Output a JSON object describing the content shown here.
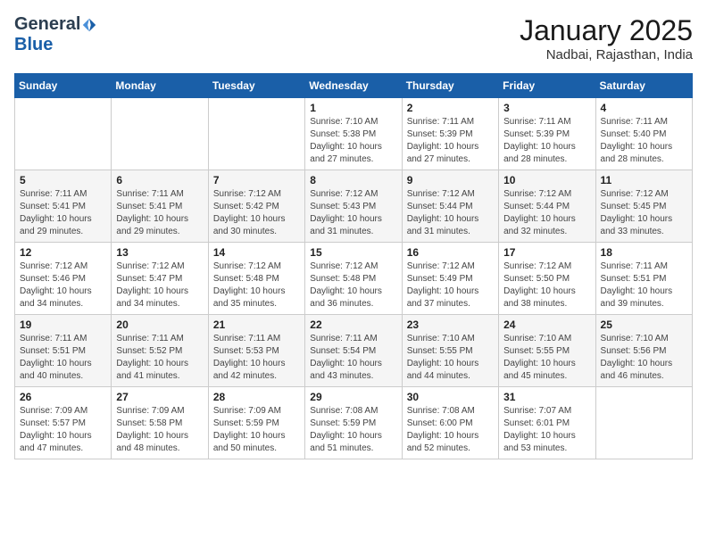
{
  "logo": {
    "general": "General",
    "blue": "Blue"
  },
  "header": {
    "month": "January 2025",
    "location": "Nadbai, Rajasthan, India"
  },
  "days_of_week": [
    "Sunday",
    "Monday",
    "Tuesday",
    "Wednesday",
    "Thursday",
    "Friday",
    "Saturday"
  ],
  "weeks": [
    [
      {
        "day": "",
        "info": ""
      },
      {
        "day": "",
        "info": ""
      },
      {
        "day": "",
        "info": ""
      },
      {
        "day": "1",
        "info": "Sunrise: 7:10 AM\nSunset: 5:38 PM\nDaylight: 10 hours\nand 27 minutes."
      },
      {
        "day": "2",
        "info": "Sunrise: 7:11 AM\nSunset: 5:39 PM\nDaylight: 10 hours\nand 27 minutes."
      },
      {
        "day": "3",
        "info": "Sunrise: 7:11 AM\nSunset: 5:39 PM\nDaylight: 10 hours\nand 28 minutes."
      },
      {
        "day": "4",
        "info": "Sunrise: 7:11 AM\nSunset: 5:40 PM\nDaylight: 10 hours\nand 28 minutes."
      }
    ],
    [
      {
        "day": "5",
        "info": "Sunrise: 7:11 AM\nSunset: 5:41 PM\nDaylight: 10 hours\nand 29 minutes."
      },
      {
        "day": "6",
        "info": "Sunrise: 7:11 AM\nSunset: 5:41 PM\nDaylight: 10 hours\nand 29 minutes."
      },
      {
        "day": "7",
        "info": "Sunrise: 7:12 AM\nSunset: 5:42 PM\nDaylight: 10 hours\nand 30 minutes."
      },
      {
        "day": "8",
        "info": "Sunrise: 7:12 AM\nSunset: 5:43 PM\nDaylight: 10 hours\nand 31 minutes."
      },
      {
        "day": "9",
        "info": "Sunrise: 7:12 AM\nSunset: 5:44 PM\nDaylight: 10 hours\nand 31 minutes."
      },
      {
        "day": "10",
        "info": "Sunrise: 7:12 AM\nSunset: 5:44 PM\nDaylight: 10 hours\nand 32 minutes."
      },
      {
        "day": "11",
        "info": "Sunrise: 7:12 AM\nSunset: 5:45 PM\nDaylight: 10 hours\nand 33 minutes."
      }
    ],
    [
      {
        "day": "12",
        "info": "Sunrise: 7:12 AM\nSunset: 5:46 PM\nDaylight: 10 hours\nand 34 minutes."
      },
      {
        "day": "13",
        "info": "Sunrise: 7:12 AM\nSunset: 5:47 PM\nDaylight: 10 hours\nand 34 minutes."
      },
      {
        "day": "14",
        "info": "Sunrise: 7:12 AM\nSunset: 5:48 PM\nDaylight: 10 hours\nand 35 minutes."
      },
      {
        "day": "15",
        "info": "Sunrise: 7:12 AM\nSunset: 5:48 PM\nDaylight: 10 hours\nand 36 minutes."
      },
      {
        "day": "16",
        "info": "Sunrise: 7:12 AM\nSunset: 5:49 PM\nDaylight: 10 hours\nand 37 minutes."
      },
      {
        "day": "17",
        "info": "Sunrise: 7:12 AM\nSunset: 5:50 PM\nDaylight: 10 hours\nand 38 minutes."
      },
      {
        "day": "18",
        "info": "Sunrise: 7:11 AM\nSunset: 5:51 PM\nDaylight: 10 hours\nand 39 minutes."
      }
    ],
    [
      {
        "day": "19",
        "info": "Sunrise: 7:11 AM\nSunset: 5:51 PM\nDaylight: 10 hours\nand 40 minutes."
      },
      {
        "day": "20",
        "info": "Sunrise: 7:11 AM\nSunset: 5:52 PM\nDaylight: 10 hours\nand 41 minutes."
      },
      {
        "day": "21",
        "info": "Sunrise: 7:11 AM\nSunset: 5:53 PM\nDaylight: 10 hours\nand 42 minutes."
      },
      {
        "day": "22",
        "info": "Sunrise: 7:11 AM\nSunset: 5:54 PM\nDaylight: 10 hours\nand 43 minutes."
      },
      {
        "day": "23",
        "info": "Sunrise: 7:10 AM\nSunset: 5:55 PM\nDaylight: 10 hours\nand 44 minutes."
      },
      {
        "day": "24",
        "info": "Sunrise: 7:10 AM\nSunset: 5:55 PM\nDaylight: 10 hours\nand 45 minutes."
      },
      {
        "day": "25",
        "info": "Sunrise: 7:10 AM\nSunset: 5:56 PM\nDaylight: 10 hours\nand 46 minutes."
      }
    ],
    [
      {
        "day": "26",
        "info": "Sunrise: 7:09 AM\nSunset: 5:57 PM\nDaylight: 10 hours\nand 47 minutes."
      },
      {
        "day": "27",
        "info": "Sunrise: 7:09 AM\nSunset: 5:58 PM\nDaylight: 10 hours\nand 48 minutes."
      },
      {
        "day": "28",
        "info": "Sunrise: 7:09 AM\nSunset: 5:59 PM\nDaylight: 10 hours\nand 50 minutes."
      },
      {
        "day": "29",
        "info": "Sunrise: 7:08 AM\nSunset: 5:59 PM\nDaylight: 10 hours\nand 51 minutes."
      },
      {
        "day": "30",
        "info": "Sunrise: 7:08 AM\nSunset: 6:00 PM\nDaylight: 10 hours\nand 52 minutes."
      },
      {
        "day": "31",
        "info": "Sunrise: 7:07 AM\nSunset: 6:01 PM\nDaylight: 10 hours\nand 53 minutes."
      },
      {
        "day": "",
        "info": ""
      }
    ]
  ]
}
